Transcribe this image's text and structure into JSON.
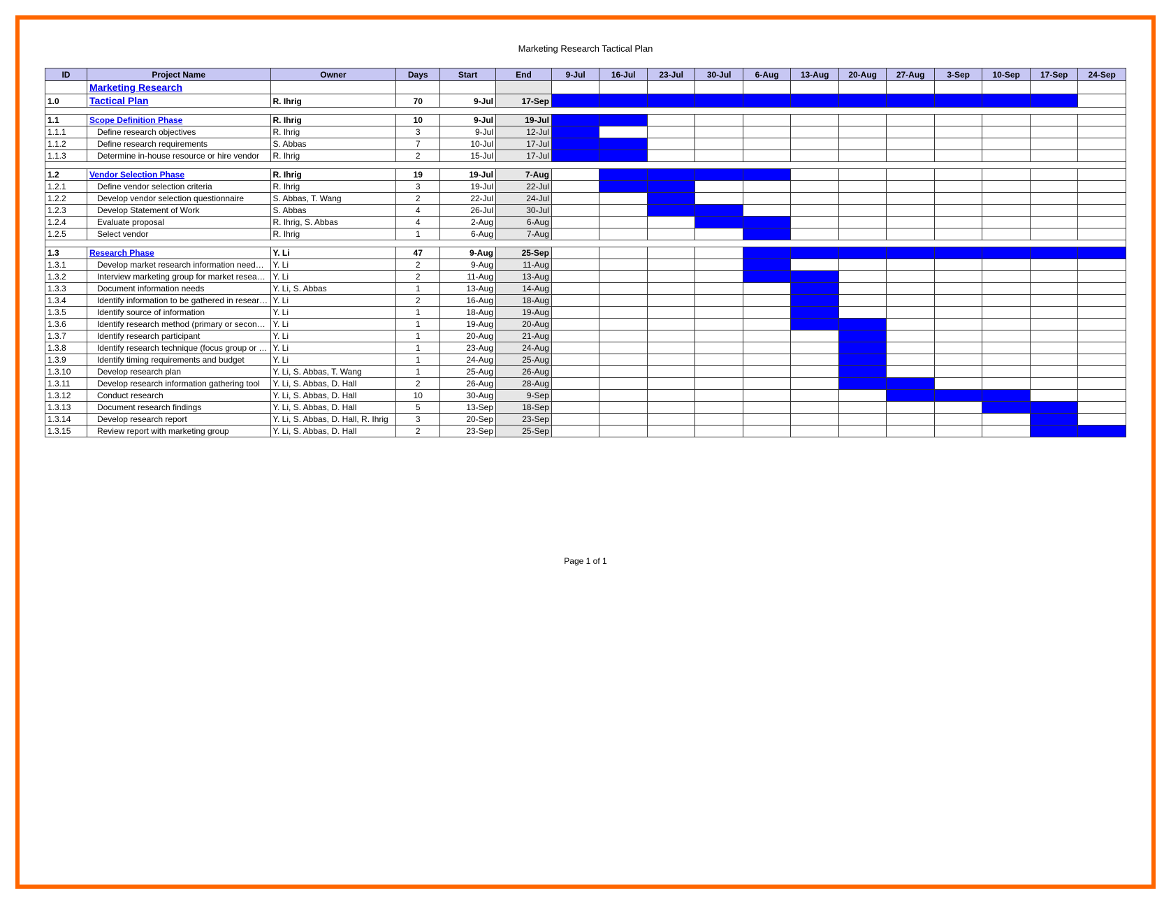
{
  "title": "Marketing Research Tactical Plan",
  "footer": "Page 1 of 1",
  "headers": {
    "id": "ID",
    "name": "Project Name",
    "owner": "Owner",
    "days": "Days",
    "start": "Start",
    "end": "End"
  },
  "dateCols": [
    "9-Jul",
    "16-Jul",
    "23-Jul",
    "30-Jul",
    "6-Aug",
    "13-Aug",
    "20-Aug",
    "27-Aug",
    "3-Sep",
    "10-Sep",
    "17-Sep",
    "24-Sep"
  ],
  "rows": [
    {
      "type": "header2",
      "id": "",
      "name": "Marketing Research",
      "owner": "",
      "days": "",
      "start": "",
      "end": "",
      "bars": []
    },
    {
      "type": "header1",
      "id": "1.0",
      "name": "Tactical Plan",
      "owner": "R. Ihrig",
      "days": "70",
      "start": "9-Jul",
      "end": "17-Sep",
      "bars": [
        0,
        1,
        2,
        3,
        4,
        5,
        6,
        7,
        8,
        9,
        10
      ]
    },
    {
      "type": "spacer"
    },
    {
      "type": "phase",
      "id": "1.1",
      "name": "Scope Definition Phase",
      "owner": "R. Ihrig",
      "days": "10",
      "start": "9-Jul",
      "end": "19-Jul",
      "bars": [
        0,
        1
      ]
    },
    {
      "type": "task",
      "id": "1.1.1",
      "name": "Define research objectives",
      "owner": "R. Ihrig",
      "days": "3",
      "start": "9-Jul",
      "end": "12-Jul",
      "bars": [
        0
      ]
    },
    {
      "type": "task",
      "id": "1.1.2",
      "name": "Define research requirements",
      "owner": "S. Abbas",
      "days": "7",
      "start": "10-Jul",
      "end": "17-Jul",
      "bars": [
        0,
        1
      ]
    },
    {
      "type": "task",
      "id": "1.1.3",
      "name": "Determine in-house resource or hire vendor",
      "owner": "R. Ihrig",
      "days": "2",
      "start": "15-Jul",
      "end": "17-Jul",
      "bars": [
        0,
        1
      ]
    },
    {
      "type": "spacer"
    },
    {
      "type": "phase",
      "id": "1.2",
      "name": "Vendor Selection Phase",
      "owner": "R. Ihrig",
      "days": "19",
      "start": "19-Jul",
      "end": "7-Aug",
      "bars": [
        1,
        2,
        3,
        4
      ]
    },
    {
      "type": "task",
      "id": "1.2.1",
      "name": "Define vendor selection criteria",
      "owner": "R. Ihrig",
      "days": "3",
      "start": "19-Jul",
      "end": "22-Jul",
      "bars": [
        1,
        2
      ]
    },
    {
      "type": "task",
      "id": "1.2.2",
      "name": "Develop vendor selection questionnaire",
      "owner": "S. Abbas, T. Wang",
      "days": "2",
      "start": "22-Jul",
      "end": "24-Jul",
      "bars": [
        2
      ]
    },
    {
      "type": "task",
      "id": "1.2.3",
      "name": "Develop Statement of Work",
      "owner": "S. Abbas",
      "days": "4",
      "start": "26-Jul",
      "end": "30-Jul",
      "bars": [
        2,
        3
      ]
    },
    {
      "type": "task",
      "id": "1.2.4",
      "name": "Evaluate proposal",
      "owner": "R. Ihrig, S. Abbas",
      "days": "4",
      "start": "2-Aug",
      "end": "6-Aug",
      "bars": [
        3,
        4
      ]
    },
    {
      "type": "task",
      "id": "1.2.5",
      "name": "Select vendor",
      "owner": "R. Ihrig",
      "days": "1",
      "start": "6-Aug",
      "end": "7-Aug",
      "bars": [
        4
      ]
    },
    {
      "type": "spacer"
    },
    {
      "type": "phase",
      "id": "1.3",
      "name": "Research Phase",
      "owner": "Y. Li",
      "days": "47",
      "start": "9-Aug",
      "end": "25-Sep",
      "bars": [
        4,
        5,
        6,
        7,
        8,
        9,
        10,
        11
      ]
    },
    {
      "type": "task",
      "id": "1.3.1",
      "name": "Develop market research information needs questionnaire",
      "owner": "Y. Li",
      "days": "2",
      "start": "9-Aug",
      "end": "11-Aug",
      "bars": [
        4
      ]
    },
    {
      "type": "task",
      "id": "1.3.2",
      "name": "Interview marketing group for market research needs",
      "owner": "Y. Li",
      "days": "2",
      "start": "11-Aug",
      "end": "13-Aug",
      "bars": [
        4,
        5
      ]
    },
    {
      "type": "task",
      "id": "1.3.3",
      "name": "Document information needs",
      "owner": "Y. Li, S. Abbas",
      "days": "1",
      "start": "13-Aug",
      "end": "14-Aug",
      "bars": [
        5
      ]
    },
    {
      "type": "task",
      "id": "1.3.4",
      "name": "Identify information to be gathered in research",
      "owner": "Y. Li",
      "days": "2",
      "start": "16-Aug",
      "end": "18-Aug",
      "bars": [
        5
      ]
    },
    {
      "type": "task",
      "id": "1.3.5",
      "name": "Identify source of information",
      "owner": "Y. Li",
      "days": "1",
      "start": "18-Aug",
      "end": "19-Aug",
      "bars": [
        5
      ]
    },
    {
      "type": "task",
      "id": "1.3.6",
      "name": "Identify research method (primary or secondary)",
      "owner": "Y. Li",
      "days": "1",
      "start": "19-Aug",
      "end": "20-Aug",
      "bars": [
        5,
        6
      ]
    },
    {
      "type": "task",
      "id": "1.3.7",
      "name": "Identify research participant",
      "owner": "Y. Li",
      "days": "1",
      "start": "20-Aug",
      "end": "21-Aug",
      "bars": [
        6
      ]
    },
    {
      "type": "task",
      "id": "1.3.8",
      "name": "Identify research technique (focus group or survey)",
      "owner": "Y. Li",
      "days": "1",
      "start": "23-Aug",
      "end": "24-Aug",
      "bars": [
        6
      ]
    },
    {
      "type": "task",
      "id": "1.3.9",
      "name": "Identify timing requirements and budget",
      "owner": "Y. Li",
      "days": "1",
      "start": "24-Aug",
      "end": "25-Aug",
      "bars": [
        6
      ]
    },
    {
      "type": "task",
      "id": "1.3.10",
      "name": "Develop research plan",
      "owner": "Y. Li, S. Abbas, T. Wang",
      "days": "1",
      "start": "25-Aug",
      "end": "26-Aug",
      "bars": [
        6
      ]
    },
    {
      "type": "task",
      "id": "1.3.11",
      "name": "Develop research information gathering tool",
      "owner": "Y. Li, S. Abbas, D. Hall",
      "days": "2",
      "start": "26-Aug",
      "end": "28-Aug",
      "bars": [
        6,
        7
      ]
    },
    {
      "type": "task",
      "id": "1.3.12",
      "name": "Conduct research",
      "owner": "Y. Li, S. Abbas, D. Hall",
      "days": "10",
      "start": "30-Aug",
      "end": "9-Sep",
      "bars": [
        7,
        8,
        9
      ]
    },
    {
      "type": "task",
      "id": "1.3.13",
      "name": "Document research findings",
      "owner": "Y. Li, S. Abbas, D. Hall",
      "days": "5",
      "start": "13-Sep",
      "end": "18-Sep",
      "bars": [
        9,
        10
      ]
    },
    {
      "type": "task",
      "id": "1.3.14",
      "name": "Develop research report",
      "owner": "Y. Li, S. Abbas, D. Hall, R. Ihrig",
      "days": "3",
      "start": "20-Sep",
      "end": "23-Sep",
      "bars": [
        10
      ]
    },
    {
      "type": "task",
      "id": "1.3.15",
      "name": "Review report with marketing group",
      "owner": "Y. Li, S. Abbas, D. Hall",
      "days": "2",
      "start": "23-Sep",
      "end": "25-Sep",
      "bars": [
        10,
        11
      ]
    }
  ]
}
